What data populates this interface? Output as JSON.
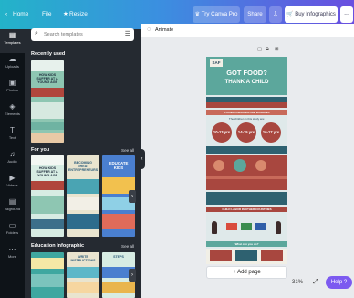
{
  "topbar": {
    "home": "Home",
    "file": "File",
    "resize": "Resize",
    "try_pro": "Try Canva Pro",
    "share": "Share",
    "download_icon": "download-icon",
    "buy": "Buy Infographics",
    "more": "..."
  },
  "rail": {
    "items": [
      {
        "label": "Templates",
        "icon": "templates-icon"
      },
      {
        "label": "Uploads",
        "icon": "upload-icon"
      },
      {
        "label": "Photos",
        "icon": "photos-icon"
      },
      {
        "label": "Elements",
        "icon": "elements-icon"
      },
      {
        "label": "Text",
        "icon": "text-icon"
      },
      {
        "label": "Audio",
        "icon": "audio-icon"
      },
      {
        "label": "Videos",
        "icon": "video-icon"
      },
      {
        "label": "Bkground",
        "icon": "background-icon"
      },
      {
        "label": "Folders",
        "icon": "folder-icon"
      },
      {
        "label": "More",
        "icon": "more-icon"
      }
    ]
  },
  "panel": {
    "search_placeholder": "Search templates",
    "recently_used": "Recently used",
    "for_you": "For you",
    "see_all": "See all",
    "education": "Education Infographic",
    "recent_thumb_text": [
      "HOW KIDS SUFFER AT A YOUNG AGE"
    ],
    "foryou_thumbs": [
      "HOW KIDS SUFFER AT A YOUNG AGE",
      "BECOMING GREAT ENTREPRENEURS",
      "EDUCATE KIDS"
    ],
    "edu_thumbs": [
      "",
      "WRITE INSTRUCTIONS",
      "STEPS"
    ]
  },
  "canvas": {
    "animate": "Animate",
    "add_page": "+ Add page",
    "zoom": "31%",
    "help": "Help ?"
  },
  "infographic": {
    "logo": "SAF",
    "headline_1": "GOT FOOD?",
    "headline_2": "THANK A CHILD",
    "section_1": "YOUNG CHILDREN ARE WORKING",
    "subline": "The children in this study are:",
    "ages": [
      "10-13 yrs",
      "14-15 yrs",
      "16-17 yrs"
    ],
    "section_2": "CHILD LABOR IN OTHER COUNTRIES",
    "section_3": "What can you do?"
  },
  "colors": {
    "rail_bg": "#0e1318",
    "panel_bg": "#252a31",
    "accent": "#7c5af0",
    "infographic_red": "#a8473f",
    "infographic_teal": "#5ca79c"
  }
}
